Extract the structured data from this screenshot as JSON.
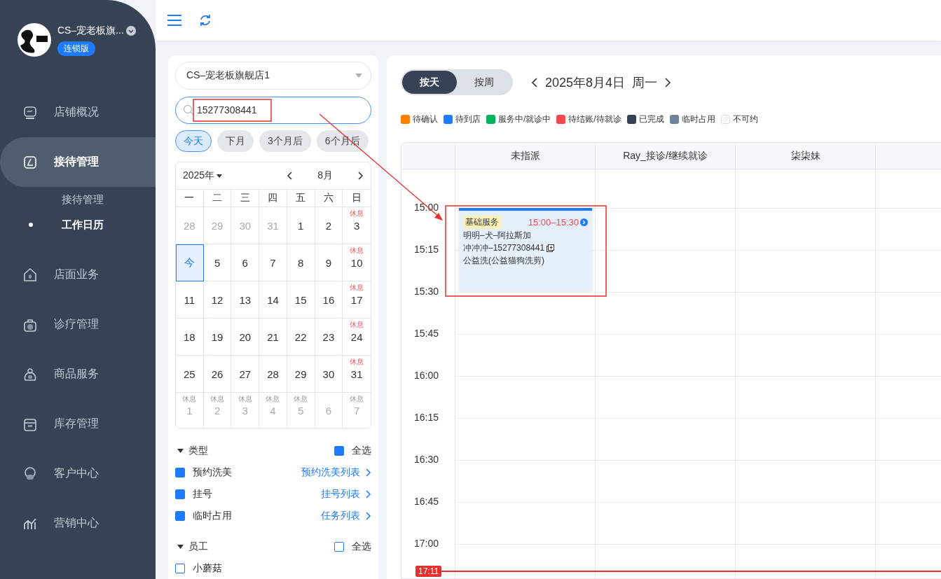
{
  "sidebar": {
    "store": {
      "name": "CS–宠老板旗...",
      "badge": "连锁版"
    },
    "items": [
      {
        "label": "店铺概况",
        "selected": false
      },
      {
        "label": "接待管理",
        "selected": true,
        "children": [
          {
            "label": "接待管理",
            "selected": false
          },
          {
            "label": "工作日历",
            "selected": true
          }
        ]
      },
      {
        "label": "店面业务",
        "selected": false
      },
      {
        "label": "诊疗管理",
        "selected": false
      },
      {
        "label": "商品服务",
        "selected": false
      },
      {
        "label": "库存管理",
        "selected": false
      },
      {
        "label": "客户中心",
        "selected": false
      },
      {
        "label": "营销中心",
        "selected": false
      }
    ]
  },
  "filter_panel": {
    "store_select": {
      "value": "CS–宠老板旗舰店1"
    },
    "search": {
      "value": "15277308441"
    },
    "quick_ranges": [
      {
        "label": "今天",
        "selected": true
      },
      {
        "label": "下月",
        "selected": false
      },
      {
        "label": "3个月后",
        "selected": false
      },
      {
        "label": "6个月后",
        "selected": false
      }
    ],
    "mini_calendar": {
      "year": "2025年",
      "month": "8月",
      "weekdays": [
        "一",
        "二",
        "三",
        "四",
        "五",
        "六",
        "日"
      ],
      "weeks": [
        [
          {
            "day": "28",
            "kind": "other"
          },
          {
            "day": "29",
            "kind": "other"
          },
          {
            "day": "30",
            "kind": "other"
          },
          {
            "day": "31",
            "kind": "other"
          },
          {
            "day": "1",
            "kind": "current"
          },
          {
            "day": "2",
            "kind": "current"
          },
          {
            "day": "3",
            "kind": "current",
            "note": "休息"
          }
        ],
        [
          {
            "day": "今",
            "kind": "today"
          },
          {
            "day": "5",
            "kind": "current"
          },
          {
            "day": "6",
            "kind": "current"
          },
          {
            "day": "7",
            "kind": "current"
          },
          {
            "day": "8",
            "kind": "current"
          },
          {
            "day": "9",
            "kind": "current"
          },
          {
            "day": "10",
            "kind": "current",
            "note": "休息"
          }
        ],
        [
          {
            "day": "11",
            "kind": "current"
          },
          {
            "day": "12",
            "kind": "current"
          },
          {
            "day": "13",
            "kind": "current"
          },
          {
            "day": "14",
            "kind": "current"
          },
          {
            "day": "15",
            "kind": "current"
          },
          {
            "day": "16",
            "kind": "current"
          },
          {
            "day": "17",
            "kind": "current",
            "note": "休息"
          }
        ],
        [
          {
            "day": "18",
            "kind": "current"
          },
          {
            "day": "19",
            "kind": "current"
          },
          {
            "day": "20",
            "kind": "current"
          },
          {
            "day": "21",
            "kind": "current"
          },
          {
            "day": "22",
            "kind": "current"
          },
          {
            "day": "23",
            "kind": "current"
          },
          {
            "day": "24",
            "kind": "current",
            "note": "休息"
          }
        ],
        [
          {
            "day": "25",
            "kind": "current"
          },
          {
            "day": "26",
            "kind": "current"
          },
          {
            "day": "27",
            "kind": "current"
          },
          {
            "day": "28",
            "kind": "current"
          },
          {
            "day": "29",
            "kind": "current"
          },
          {
            "day": "30",
            "kind": "current"
          },
          {
            "day": "31",
            "kind": "current",
            "note": "休息"
          }
        ],
        [
          {
            "day": "1",
            "kind": "other",
            "note": "休息"
          },
          {
            "day": "2",
            "kind": "other",
            "note": "休息"
          },
          {
            "day": "3",
            "kind": "other",
            "note": "休息"
          },
          {
            "day": "4",
            "kind": "other",
            "note": "休息"
          },
          {
            "day": "5",
            "kind": "other",
            "note": "休息"
          },
          {
            "day": "6",
            "kind": "other"
          },
          {
            "day": "7",
            "kind": "other",
            "note": "休息"
          }
        ]
      ]
    },
    "groups": [
      {
        "title": "类型",
        "expanded": true,
        "all": {
          "label": "全选",
          "checked": true
        },
        "items": [
          {
            "label": "预约洗美",
            "checked": true,
            "link": "预约洗美列表"
          },
          {
            "label": "挂号",
            "checked": true,
            "link": "挂号列表"
          },
          {
            "label": "临时占用",
            "checked": true,
            "link": "任务列表"
          }
        ]
      },
      {
        "title": "员工",
        "expanded": true,
        "all": {
          "label": "全选",
          "checked": false
        },
        "items": [
          {
            "label": "小蘑菇",
            "checked": false
          }
        ]
      }
    ]
  },
  "schedule": {
    "view_tabs": [
      {
        "label": "按天",
        "selected": true
      },
      {
        "label": "按周",
        "selected": false
      }
    ],
    "date": "2025年8月4日  周一",
    "legend": [
      {
        "label": "待确认",
        "kind": "solid",
        "color": "#ff7d00"
      },
      {
        "label": "待到店",
        "kind": "solid",
        "color": "#1e7bff"
      },
      {
        "label": "服务中/就诊中",
        "kind": "solid",
        "color": "#00b259"
      },
      {
        "label": "待结账/待就诊",
        "kind": "solid",
        "color": "#f5484d"
      },
      {
        "label": "已完成",
        "kind": "solid",
        "color": "#344154"
      },
      {
        "label": "临时占用",
        "kind": "solid",
        "color": "#6e829c"
      },
      {
        "label": "不可约",
        "kind": "hatched"
      }
    ],
    "columns": [
      {
        "label": "未指派"
      },
      {
        "label": "Ray_接诊/继续就诊"
      },
      {
        "label": "柒柒妹"
      },
      {}
    ],
    "times": [
      "15:00",
      "15:15",
      "15:30",
      "15:45",
      "16:00",
      "16:15",
      "16:30",
      "16:45",
      "17:00"
    ],
    "now": "17:11",
    "appointments": [
      {
        "tag": "基础服务",
        "time": "15:00–15:30",
        "pet": "明明–犬–阿拉斯加",
        "owner": "冲冲冲–15277308441",
        "service": "公益洗(公益猫狗洗剪)"
      }
    ]
  }
}
